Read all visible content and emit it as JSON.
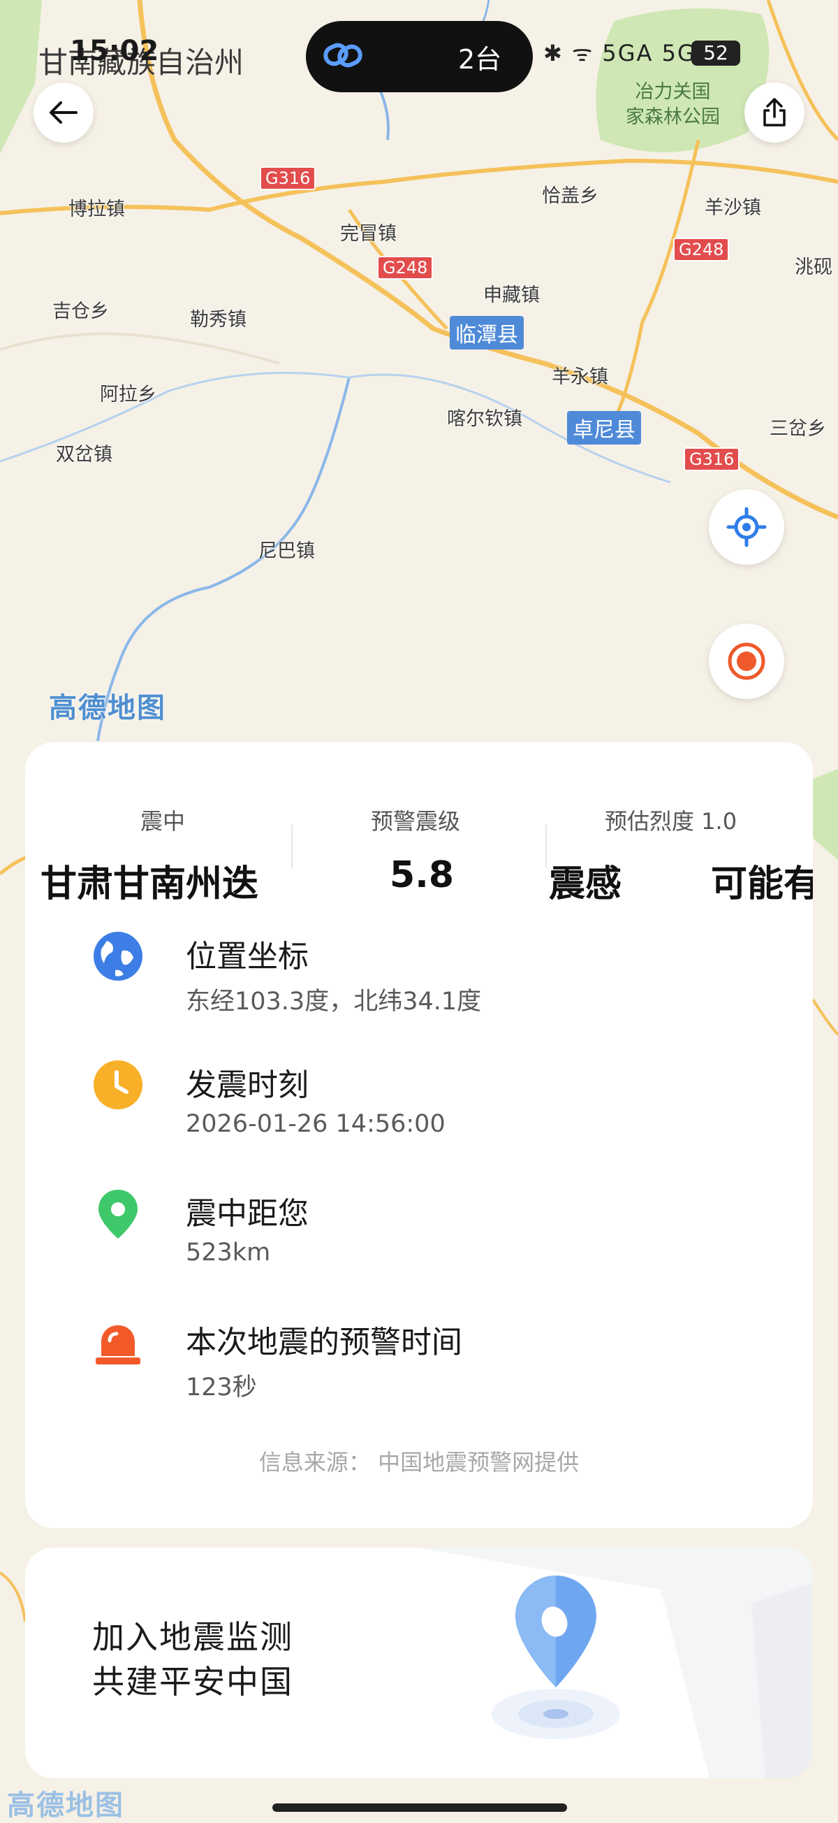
{
  "status_bar": {
    "time": "15:02",
    "behind_title": "甘南藏族自治州",
    "island_text": "2台",
    "network": "✱ ᯤ 5GA 5G",
    "battery": "52"
  },
  "map": {
    "watermark": "高德地图",
    "park_label_1": "冶力关国",
    "park_label_2": "家森林公园",
    "places": [
      "博拉镇",
      "完冒镇",
      "恰盖乡",
      "羊沙镇",
      "吉仓乡",
      "勒秀镇",
      "申藏镇",
      "洮砚",
      "阿拉乡",
      "羊永镇",
      "喀尔钦镇",
      "三岔乡",
      "双岔镇",
      "尼巴镇"
    ],
    "counties": [
      "临潭县",
      "卓尼县"
    ],
    "road_shields": [
      "G316",
      "G248",
      "G248",
      "G316"
    ]
  },
  "quake": {
    "col1_label": "震中",
    "col1_value": "甘肃甘南州迭",
    "col2_label": "预警震级",
    "col2_value": "5.8",
    "col3_label": "预估烈度 1.0",
    "col3_value": "震感",
    "col3_value_2": "可能有",
    "rows": [
      {
        "icon": "globe-icon",
        "title": "位置坐标",
        "subtitle": "东经103.3度，北纬34.1度"
      },
      {
        "icon": "clock-icon",
        "title": "发震时刻",
        "subtitle": "2026-01-26 14:56:00"
      },
      {
        "icon": "location-pin-icon",
        "title": "震中距您",
        "subtitle": "523km"
      },
      {
        "icon": "alarm-light-icon",
        "title": "本次地震的预警时间",
        "subtitle": "123秒"
      }
    ],
    "source": "信息来源：  中国地震预警网提供"
  },
  "join": {
    "line1": "加入地震监测",
    "line2": "共建平安中国"
  },
  "colors": {
    "globe": "#3d7ee6",
    "clock": "#f7b027",
    "pin": "#3fc86a",
    "alarm": "#f25a2a",
    "record": "#ee5a2c",
    "locate": "#2f7de8"
  }
}
